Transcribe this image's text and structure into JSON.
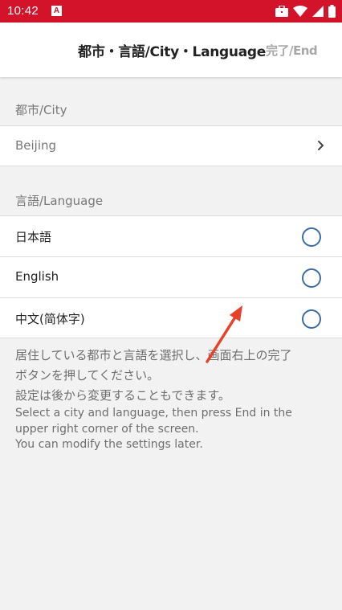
{
  "status_bar": {
    "time": "10:42",
    "notification_letter": "A",
    "icons": [
      "briefcase-icon",
      "wifi-icon",
      "signal-icon",
      "battery-icon"
    ]
  },
  "app_bar": {
    "title": "都市・言語/City・Language",
    "end_label": "完了/End"
  },
  "city_section": {
    "header": "都市/City",
    "selected_city": "Beijing"
  },
  "language_section": {
    "header": "言語/Language",
    "options": [
      {
        "label": "日本語",
        "selected": false
      },
      {
        "label": "English",
        "selected": false
      },
      {
        "label": "中文(简体字)",
        "selected": false
      }
    ]
  },
  "help": {
    "jp_line1": "居住している都市と言語を選択し、画面右上の完了",
    "jp_line2": "ボタンを押してください。",
    "jp_line3": "設定は後から変更することもできます。",
    "en_line1": "Select a city and language, then press End in the",
    "en_line2": "upper right corner of the screen.",
    "en_line3": "You can modify the settings later."
  },
  "colors": {
    "status_bar": "#d2132a",
    "radio_ring": "#3d6da3",
    "annotation_arrow": "#e8402a"
  }
}
